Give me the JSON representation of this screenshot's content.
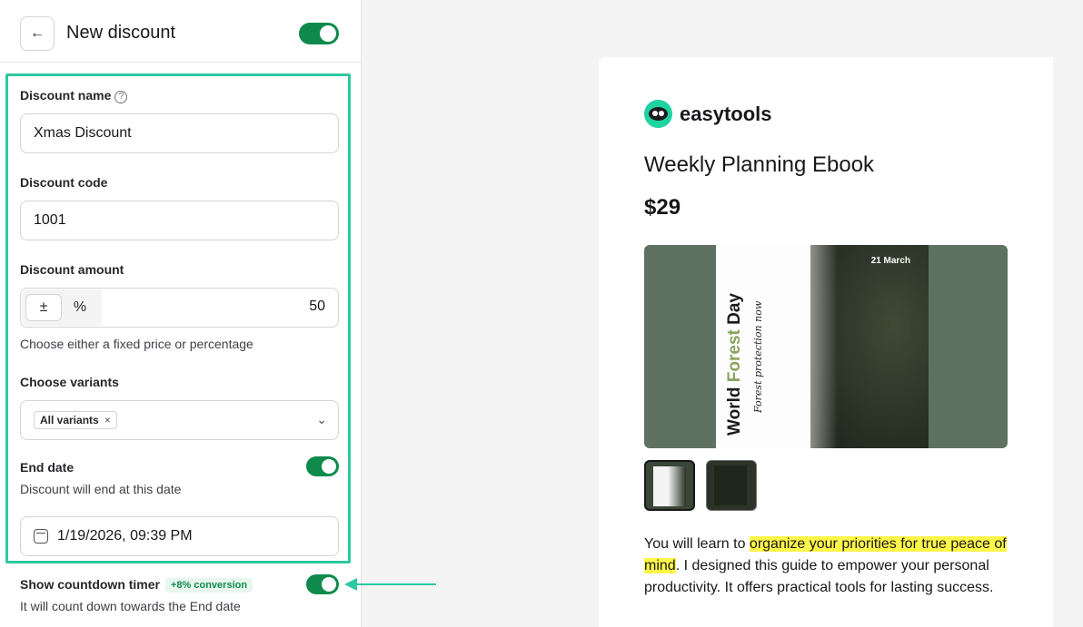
{
  "header": {
    "title": "New discount",
    "back_icon": "←",
    "enabled": true
  },
  "form": {
    "discount_name": {
      "label": "Discount name",
      "help_icon": "?",
      "value": "Xmas Discount"
    },
    "discount_code": {
      "label": "Discount code",
      "value": "1001"
    },
    "discount_amount": {
      "label": "Discount amount",
      "fixed_symbol": "±",
      "percent_symbol": "%",
      "value": "50",
      "hint": "Choose either a fixed price or percentage"
    },
    "variants": {
      "label": "Choose variants",
      "chip": "All variants",
      "chip_remove": "×",
      "chevron": "⌄"
    },
    "end_date": {
      "label": "End date",
      "hint": "Discount will end at this date",
      "enabled": true,
      "value": "1/19/2026, 09:39 PM"
    },
    "countdown": {
      "label": "Show countdown timer",
      "badge": "+8% conversion",
      "hint": "It will count down towards the End date",
      "enabled": true
    }
  },
  "preview": {
    "brand": "easytools",
    "product_title": "Weekly Planning Ebook",
    "price": "$29",
    "cover": {
      "title_world": "World ",
      "title_forest": "Forest",
      "title_day": " Day",
      "subtitle": "Forest protection now",
      "date": "21 March"
    },
    "description": {
      "part1": "You will learn to ",
      "highlight": "organize your priorities for true peace of mind",
      "part2": ". I designed this guide to empower your personal productivity. It offers practical tools for lasting success."
    }
  },
  "colors": {
    "accent_green": "#0f8a4c",
    "highlight_teal": "#2dc9a0",
    "marker_yellow": "#fff64a"
  }
}
